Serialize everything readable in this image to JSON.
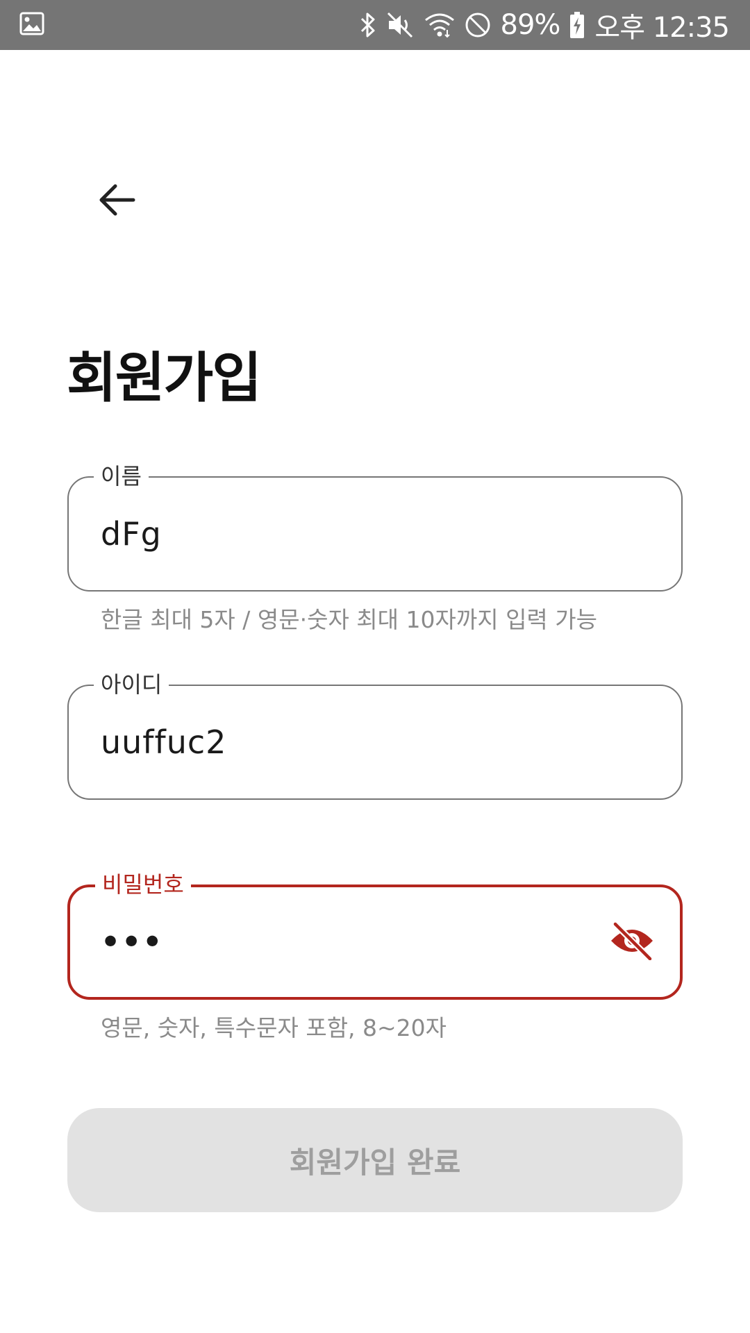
{
  "status_bar": {
    "battery": "89%",
    "time": "오후 12:35",
    "icons": [
      "gallery-icon",
      "bluetooth-icon",
      "mute-icon",
      "wifi-icon",
      "do-not-disturb-icon",
      "battery-charging-icon"
    ]
  },
  "header": {
    "back_icon": "arrow-left-icon",
    "title": "회원가입"
  },
  "form": {
    "name": {
      "label": "이름",
      "value": "dFg",
      "helper": "한글 최대 5자 / 영문·숫자 최대 10자까지 입력 가능"
    },
    "id": {
      "label": "아이디",
      "value": "uuffuc2"
    },
    "password": {
      "label": "비밀번호",
      "value": "•••",
      "helper": "영문, 숫자, 특수문자 포함, 8~20자",
      "toggle_icon": "eye-off-icon",
      "state": "error"
    }
  },
  "submit": {
    "label": "회원가입 완료",
    "enabled": false
  },
  "colors": {
    "status_bar": "#757575",
    "error": "#b3261e",
    "field_border": "#767676",
    "button_disabled_bg": "#e2e2e2",
    "button_disabled_text": "#9e9e9e",
    "helper_text": "#8a8a8a"
  }
}
